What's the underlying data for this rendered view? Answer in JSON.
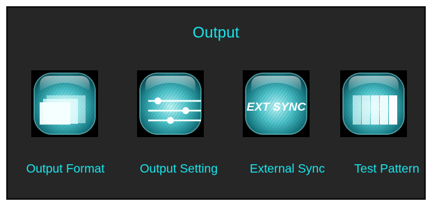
{
  "screen": {
    "title": "Output"
  },
  "items": [
    {
      "label": "Output Format",
      "icon": "output-format-icon"
    },
    {
      "label": "Output Setting",
      "icon": "output-setting-icon"
    },
    {
      "label": "External Sync",
      "icon": "external-sync-icon",
      "icon_text": "EXT SYNC"
    },
    {
      "label": "Test Pattern",
      "icon": "test-pattern-icon"
    }
  ],
  "colors": {
    "accent": "#19e6ee",
    "panel_background": "#262626",
    "icon_glass": "#3fb6bd"
  }
}
